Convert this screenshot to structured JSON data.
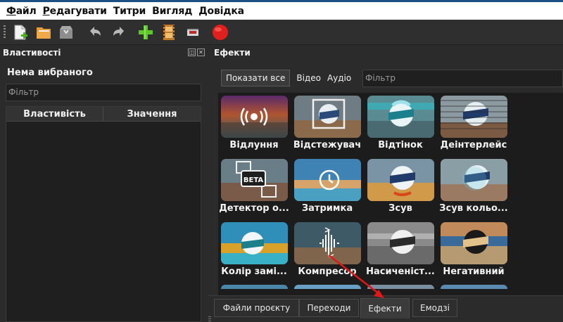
{
  "menubar": {
    "items": [
      {
        "label": "Файл",
        "mnemonic": "Ф",
        "rest": "айл"
      },
      {
        "label": "Редагувати",
        "mnemonic": "Р",
        "rest": "едагувати"
      },
      {
        "label": "Титри",
        "mnemonic": "",
        "rest": "Титри"
      },
      {
        "label": "Вигляд",
        "mnemonic": "",
        "rest": "Вигляд"
      },
      {
        "label": "Довідка",
        "mnemonic": "",
        "rest": "Довідка"
      }
    ]
  },
  "toolbar": {
    "icons": [
      "new-project-icon",
      "open-project-icon",
      "save-project-icon",
      "undo-icon",
      "redo-icon",
      "import-files-icon",
      "choose-profile-icon",
      "fullscreen-icon",
      "export-video-icon"
    ]
  },
  "properties_panel": {
    "title": "Властивості",
    "nothing_selected": "Нема вибраного",
    "filter_placeholder": "Фільтр",
    "col_property": "Властивість",
    "col_value": "Значення"
  },
  "effects_panel": {
    "title": "Ефекти",
    "show_all": "Показати все",
    "video": "Відео",
    "audio": "Аудіо",
    "filter_placeholder": "Фільтр",
    "effects": [
      {
        "label": "Відлуння",
        "icon": "echo-icon"
      },
      {
        "label": "Відстежувач",
        "icon": "tracker-icon"
      },
      {
        "label": "Відтінок",
        "icon": "hue-icon"
      },
      {
        "label": "Деінтерлейс",
        "icon": "deinterlace-icon"
      },
      {
        "label": "Детектор о...",
        "icon": "object-detector-icon"
      },
      {
        "label": "Затримка",
        "icon": "delay-icon"
      },
      {
        "label": "Зсув",
        "icon": "shift-icon"
      },
      {
        "label": "Зсув кольо...",
        "icon": "color-shift-icon"
      },
      {
        "label": "Колір замі...",
        "icon": "color-replace-icon"
      },
      {
        "label": "Компресор",
        "icon": "compressor-icon"
      },
      {
        "label": "Насиченіст...",
        "icon": "saturation-icon"
      },
      {
        "label": "Негативний",
        "icon": "negative-icon"
      }
    ]
  },
  "tabs": [
    {
      "label": "Файли проєкту",
      "active": false
    },
    {
      "label": "Переходи",
      "active": false
    },
    {
      "label": "Ефекти",
      "active": true
    },
    {
      "label": "Емодзі",
      "active": false
    }
  ],
  "colors": {
    "accent_blue": "#1c4f86",
    "record_red": "#e0201c",
    "annotation_arrow": "#e01818"
  }
}
